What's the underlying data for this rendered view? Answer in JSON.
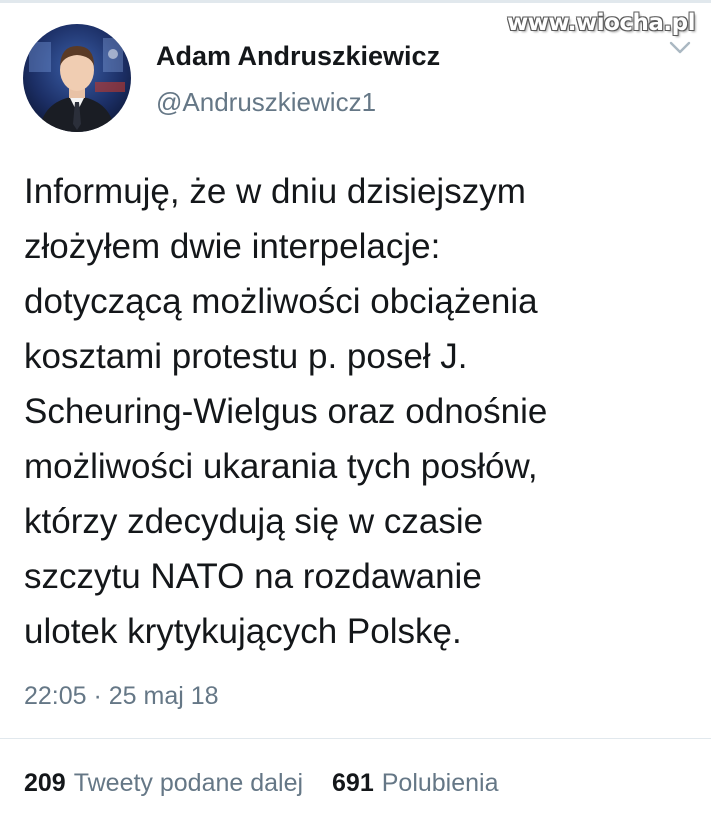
{
  "watermark": "www.wiocha.pl",
  "author": {
    "display_name": "Adam Andruszkiewicz",
    "handle": "@Andruszkiewicz1"
  },
  "tweet": {
    "lines": [
      "Informuję, że w dniu dzisiejszym",
      "złożyłem dwie interpelacje:",
      "dotyczącą możliwości obciążenia",
      "kosztami protestu p. poseł J.",
      "Scheuring-Wielgus oraz odnośnie",
      "możliwości ukarania tych posłów,",
      "którzy zdecydują się w czasie",
      "szczytu NATO na rozdawanie",
      "ulotek krytykujących Polskę."
    ],
    "timestamp": "22:05 · 25 maj 18"
  },
  "stats": {
    "retweets_count": "209",
    "retweets_label": "Tweety podane dalej",
    "likes_count": "691",
    "likes_label": "Polubienia"
  },
  "icons": {
    "menu": "chevron-down-icon"
  },
  "colors": {
    "text_primary": "#14171a",
    "text_secondary": "#657786",
    "divider": "#e1e8ed"
  }
}
